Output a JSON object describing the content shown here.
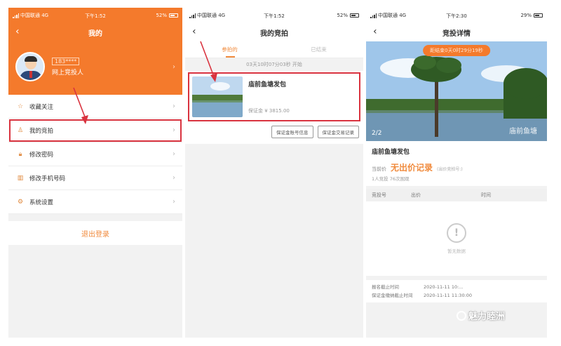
{
  "phone1": {
    "status": {
      "carrier": "中国联通 4G",
      "time": "下午1:52",
      "battery": "52%"
    },
    "title": "我的",
    "profile": {
      "username": "183****",
      "role": "网上竞投人"
    },
    "menu": [
      {
        "label": "收藏关注",
        "icon": "star-icon"
      },
      {
        "label": "我的竞拍",
        "icon": "person-icon"
      },
      {
        "label": "修改密码",
        "icon": "lock-icon"
      },
      {
        "label": "修改手机号码",
        "icon": "phone-icon"
      },
      {
        "label": "系统设置",
        "icon": "gear-icon"
      }
    ],
    "logout": "退出登录"
  },
  "phone2": {
    "status": {
      "carrier": "中国联通 4G",
      "time": "下午1:52",
      "battery": "52%"
    },
    "title": "我的竞拍",
    "tabs": [
      "参拍的",
      "已结束"
    ],
    "countdown": "03天10时07分03秒 开始",
    "item": {
      "title": "庙前鱼塘发包",
      "deposit": "保证金 ¥ 3815.00"
    },
    "buttons": [
      "保证金账号信息",
      "保证金交易记录"
    ]
  },
  "phone3": {
    "status": {
      "carrier": "中国联通 4G",
      "time": "下午2:30",
      "battery": "29%"
    },
    "title": "竞投详情",
    "countdown": "距结束0天0时29分19秒",
    "pager": "2/2",
    "photo_caption": "庙前鱼塘",
    "item_title": "庙前鱼塘发包",
    "price_label": "当前价",
    "price_value": "无出价记录",
    "price_note": "(出价竞拍号:)",
    "stats": "1人竞投  76次围观",
    "columns": [
      "竞投号",
      "出价",
      "时间"
    ],
    "empty_text": "暂无数据",
    "times": [
      {
        "label": "报名截止时间",
        "value": "2020-11-11 10:..."
      },
      {
        "label": "保证金缴纳截止时间",
        "value": "2020-11-11 11:30:00"
      }
    ]
  },
  "watermark": "魅力睦洲",
  "colors": {
    "accent": "#f47a2c",
    "highlight": "#d9333f"
  }
}
